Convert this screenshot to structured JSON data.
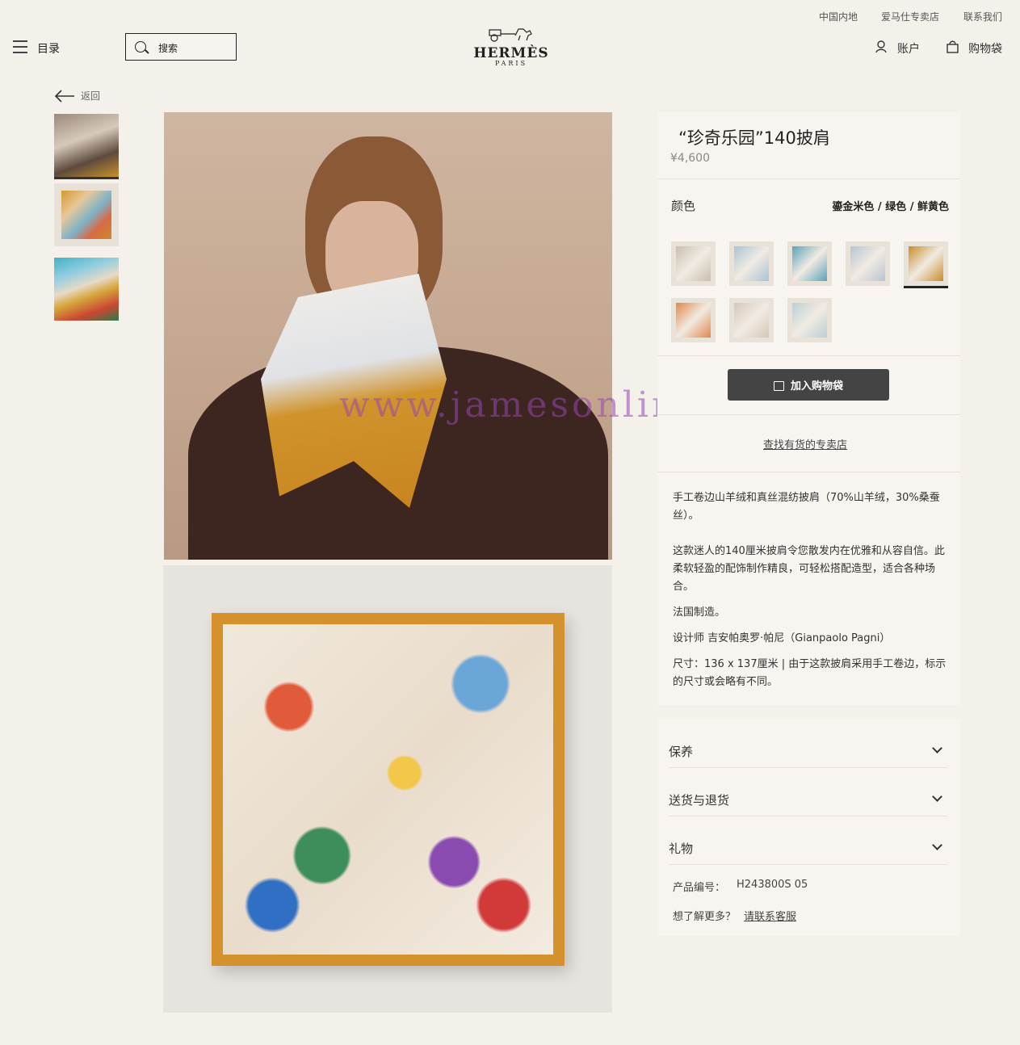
{
  "util_links": [
    "中国内地",
    "爱马仕专卖店",
    "联系我们"
  ],
  "header": {
    "menu_label": "目录",
    "search_placeholder": "搜索",
    "brand": "HERMÈS",
    "brand_sub": "PARIS",
    "account_label": "账户",
    "bag_label": "购物袋"
  },
  "back_label": "返回",
  "watermark": "www.jamesonline.ru",
  "product": {
    "title": "“珍奇乐园”140披肩",
    "price": "¥4,600",
    "color_label": "颜色",
    "color_value": "鎏金米色 / 绿色 / 鲜黄色",
    "add_to_bag": "加入购物袋",
    "find_store": "查找有货的专卖店",
    "description": [
      "手工卷边山羊绒和真丝混纺披肩（70%山羊绒，30%桑蚕丝）。",
      "这款迷人的140厘米披肩令您散发内在优雅和从容自信。此柔软轻盈的配饰制作精良，可轻松搭配造型，适合各种场合。",
      "法国制造。",
      "设计师 吉安帕奥罗·帕尼（Gianpaolo Pagni）",
      "尺寸：136 x 137厘米 | 由于这款披肩采用手工卷边，标示的尺寸或会略有不同。"
    ],
    "accordions": [
      "保养",
      "送货与退货",
      "礼物"
    ],
    "sku_label": "产品编号：",
    "sku_value": "H243800S 05",
    "more_label": "想了解更多？",
    "contact_link": "请联系客服"
  },
  "swatch_colors": [
    "#c9bfae",
    "#a9c3d3",
    "#5aa3b8",
    "#b7c4d2",
    "#c98c2a",
    "#e0894a",
    "#d8c6b8",
    "#b9cfd6"
  ],
  "selected_swatch": 4
}
